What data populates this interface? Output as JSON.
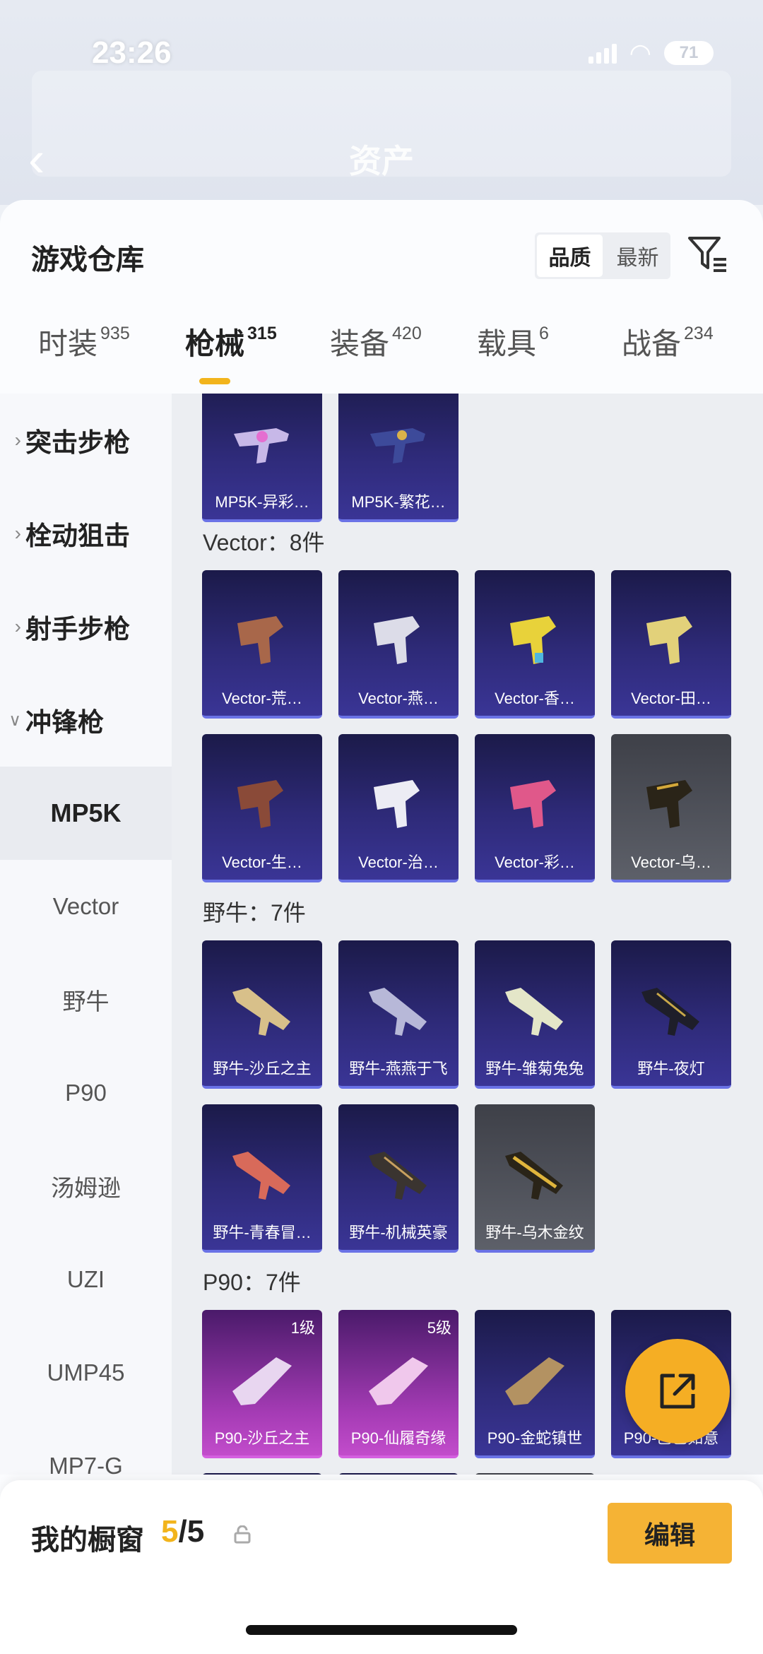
{
  "status": {
    "time": "23:26",
    "battery": "71"
  },
  "nav": {
    "title": "资产"
  },
  "sheet": {
    "title": "游戏仓库",
    "sort_options": [
      "品质",
      "最新"
    ],
    "active_sort": "品质"
  },
  "tabs": [
    {
      "label": "时装",
      "count": "935"
    },
    {
      "label": "枪械",
      "count": "315"
    },
    {
      "label": "装备",
      "count": "420"
    },
    {
      "label": "载具",
      "count": "6"
    },
    {
      "label": "战备",
      "count": "234"
    }
  ],
  "active_tab": "枪械",
  "sidebar": {
    "categories": [
      "突击步枪",
      "栓动狙击",
      "射手步枪",
      "冲锋枪"
    ],
    "subitems": [
      "MP5K",
      "Vector",
      "野牛",
      "P90",
      "汤姆逊",
      "UZI",
      "UMP45",
      "MP7-G"
    ],
    "selected": "MP5K"
  },
  "top_cards": [
    {
      "name": "MP5K-异彩…",
      "rarity": "purple"
    },
    {
      "name": "MP5K-繁花…",
      "rarity": "purple"
    }
  ],
  "sections": [
    {
      "title": "Vector：8件",
      "items": [
        {
          "name": "Vector-荒…",
          "rarity": "purple"
        },
        {
          "name": "Vector-燕…",
          "rarity": "purple"
        },
        {
          "name": "Vector-香…",
          "rarity": "purple"
        },
        {
          "name": "Vector-田…",
          "rarity": "purple"
        },
        {
          "name": "Vector-生…",
          "rarity": "purple"
        },
        {
          "name": "Vector-治…",
          "rarity": "purple"
        },
        {
          "name": "Vector-彩…",
          "rarity": "purple"
        },
        {
          "name": "Vector-乌…",
          "rarity": "gray"
        }
      ]
    },
    {
      "title": "野牛：7件",
      "items": [
        {
          "name": "野牛-沙丘之主",
          "rarity": "purple"
        },
        {
          "name": "野牛-燕燕于飞",
          "rarity": "purple"
        },
        {
          "name": "野牛-雏菊兔兔",
          "rarity": "purple"
        },
        {
          "name": "野牛-夜灯",
          "rarity": "purple"
        },
        {
          "name": "野牛-青春冒…",
          "rarity": "purple"
        },
        {
          "name": "野牛-机械英豪",
          "rarity": "purple"
        },
        {
          "name": "野牛-乌木金纹",
          "rarity": "gray"
        }
      ]
    },
    {
      "title": "P90：7件",
      "items": [
        {
          "name": "P90-沙丘之主",
          "rarity": "pink",
          "level": "1级"
        },
        {
          "name": "P90-仙履奇缘",
          "rarity": "pink",
          "level": "5级"
        },
        {
          "name": "P90-金蛇镇世",
          "rarity": "purple"
        },
        {
          "name": "P90-巳巳如意",
          "rarity": "purple"
        }
      ]
    }
  ],
  "bottom": {
    "label": "我的橱窗",
    "current": "5",
    "total": "/5",
    "edit_label": "编辑"
  },
  "icons": [
    "back-icon",
    "filter-icon",
    "chevron-right-icon",
    "chevron-down-icon",
    "share-icon",
    "lock-icon"
  ],
  "colors": {
    "accent": "#f2b41c",
    "purple_card": "#2e2a78",
    "pink_card": "#a43bb4",
    "gray_card": "#5d6069"
  }
}
